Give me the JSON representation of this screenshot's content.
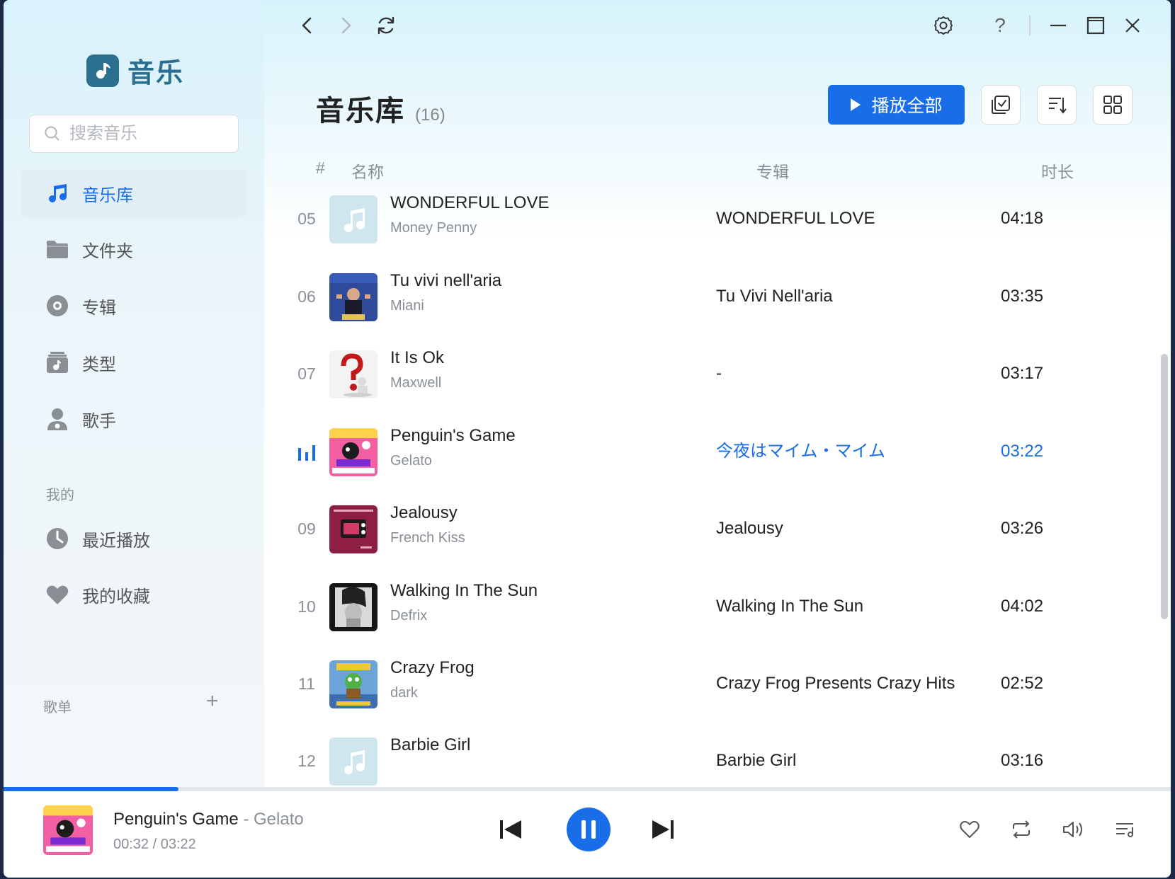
{
  "app": {
    "name": "音乐"
  },
  "search": {
    "placeholder": "搜索音乐"
  },
  "sidebar": {
    "nav": [
      {
        "label": "音乐库",
        "icon": "music-note-icon",
        "active": true
      },
      {
        "label": "文件夹",
        "icon": "folder-icon"
      },
      {
        "label": "专辑",
        "icon": "disc-icon"
      },
      {
        "label": "类型",
        "icon": "genre-icon"
      },
      {
        "label": "歌手",
        "icon": "singer-icon"
      }
    ],
    "mine_label": "我的",
    "mine": [
      {
        "label": "最近播放",
        "icon": "clock-icon"
      },
      {
        "label": "我的收藏",
        "icon": "heart-icon"
      }
    ],
    "playlists_label": "歌单",
    "add_label": "+"
  },
  "titlebar": {
    "help_label": "?"
  },
  "library": {
    "title": "音乐库",
    "count": "(16)",
    "play_all_label": "播放全部",
    "columns": {
      "index": "#",
      "name": "名称",
      "album": "专辑",
      "duration": "时长"
    },
    "tracks": [
      {
        "num": "05",
        "title": "WONDERFUL LOVE",
        "artist": "Money Penny",
        "album": "WONDERFUL LOVE",
        "duration": "04:18",
        "cover": "placeholder"
      },
      {
        "num": "06",
        "title": "Tu vivi nell'aria",
        "artist": "Miani",
        "album": "Tu Vivi Nell'aria",
        "duration": "03:35",
        "cover": "miani"
      },
      {
        "num": "07",
        "title": "It Is Ok",
        "artist": "Maxwell",
        "album": "-",
        "duration": "03:17",
        "cover": "question"
      },
      {
        "num": "",
        "title": "Penguin's Game",
        "artist": "Gelato",
        "album": "今夜はマイム・マイム",
        "duration": "03:22",
        "cover": "pink",
        "playing": true
      },
      {
        "num": "09",
        "title": "Jealousy",
        "artist": "French Kiss",
        "album": "Jealousy",
        "duration": "03:26",
        "cover": "spy"
      },
      {
        "num": "10",
        "title": "Walking In The Sun",
        "artist": "Defrix",
        "album": "Walking In The Sun",
        "duration": "04:02",
        "cover": "bw"
      },
      {
        "num": "11",
        "title": "Crazy Frog",
        "artist": "dark",
        "album": "Crazy Frog Presents Crazy Hits",
        "duration": "02:52",
        "cover": "frog"
      },
      {
        "num": "12",
        "title": "Barbie Girl",
        "artist": "",
        "album": "Barbie Girl",
        "duration": "03:16",
        "cover": "placeholder"
      }
    ]
  },
  "player": {
    "title": "Penguin's Game",
    "separator": " - ",
    "artist": "Gelato",
    "time": "00:32 / 03:22",
    "progress_fraction": 0.15
  },
  "colors": {
    "accent": "#1a6de8",
    "logo": "#2a6f8f"
  }
}
